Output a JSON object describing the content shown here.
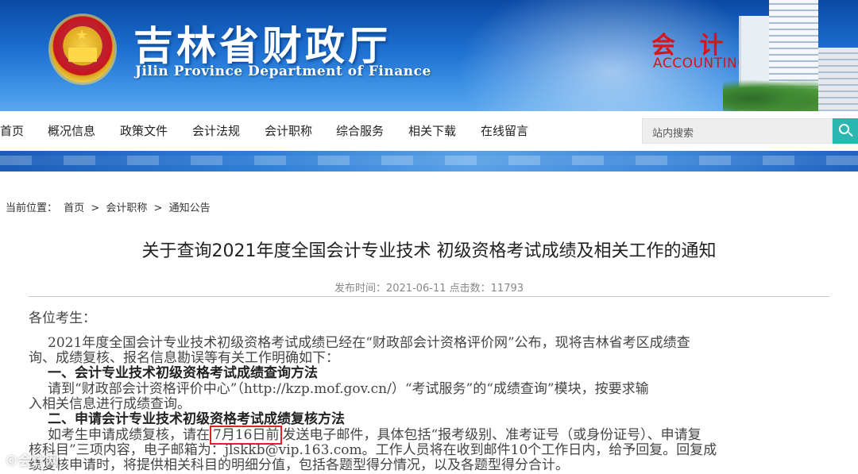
{
  "header": {
    "title": "吉林省财政厅",
    "subtitle": "Jilin Province Department of Finance",
    "accounting_cn": "会 计 网",
    "accounting_en": "ACCOUNTING"
  },
  "nav": {
    "items": [
      "首页",
      "概况信息",
      "政策文件",
      "会计法规",
      "会计职称",
      "综合服务",
      "相关下载",
      "在线留言"
    ],
    "search_placeholder": "站内搜索"
  },
  "breadcrumb": {
    "prefix": "当前位置：",
    "items": [
      "首页",
      "会计职称",
      "通知公告"
    ],
    "separator": ">"
  },
  "article": {
    "title": "关于查询2021年度全国会计专业技术 初级资格考试成绩及相关工作的通知",
    "meta": "发布时间：2021-06-11 点击数：11793",
    "greeting": "各位考生：",
    "para1_line1": "2021年度全国会计专业技术初级资格考试成绩已经在“财政部会计资格评价网”公布，现将吉林省考区成绩查",
    "para1_line2": "询、成绩复核、报名信息勘误等有关工作明确如下：",
    "heading1": "一、会计专业技术初级资格考试成绩查询方法",
    "para2_line1": "请到“财政部会计资格评价中心”（http://kzp.mof.gov.cn/）“考试服务”的“成绩查询”模块，按要求输",
    "para2_line2": "入相关信息进行成绩查询。",
    "heading2": "二、申请会计专业技术初级资格考试成绩复核方法",
    "para3_line1_a": "如考生申请成绩复核，请在",
    "para3_highlight": "7月16日前",
    "para3_line1_b": "发送电子邮件，具体包括“报考级别、准考证号（或身份证号）、申请复",
    "para3_line2": "核科目”三项内容，电子邮箱为：jlskkb@vip.163.com。工作人员将在收到邮件10个工作日内，给予回复。回复成",
    "para3_line3": "绩复核申请时，将提供相关科目的明细分值，包括各题型得分情况，以及各题型得分合计。"
  },
  "watermark": "©会计网"
}
